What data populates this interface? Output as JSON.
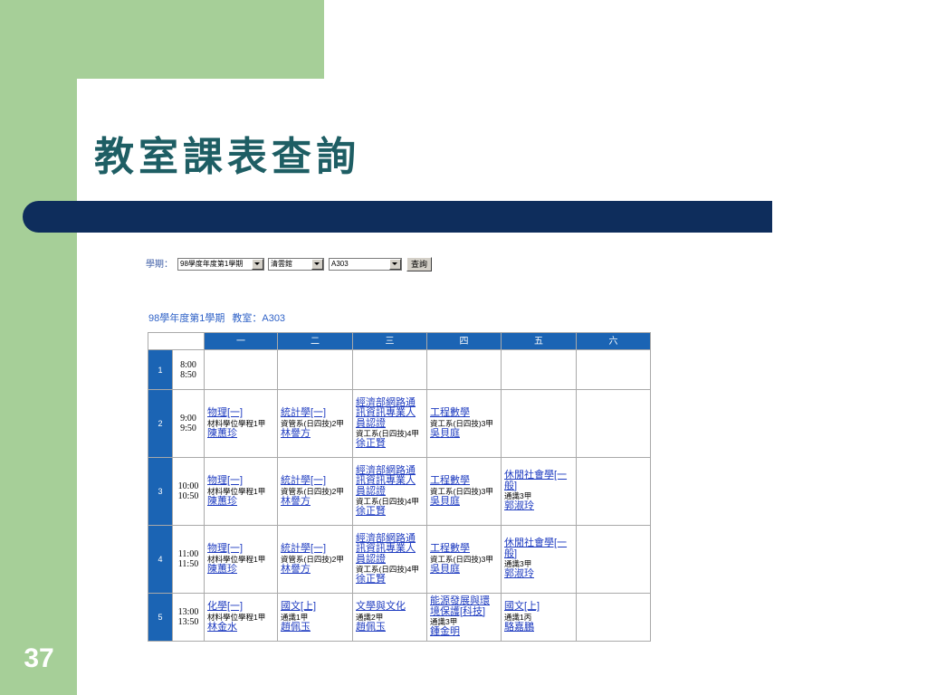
{
  "slide": {
    "title": "教室課表查詢",
    "page_number": "37"
  },
  "colors": {
    "slide_green": "#a6cf98",
    "title_text": "#1e5e64",
    "title_bar": "#0e2d5c",
    "table_header": "#1b64b4",
    "link": "#1f3cc0"
  },
  "form": {
    "semester_label": "學期：",
    "semester_select": "98學度年度第1學期",
    "building_select": "清雲館",
    "room_select": "A303",
    "query_button": "查詢"
  },
  "schedule": {
    "heading": {
      "semester": "98學年度第1學期",
      "room": "教室：A303"
    },
    "days": [
      "一",
      "二",
      "三",
      "四",
      "五",
      "六"
    ],
    "periods": [
      {
        "no": "1",
        "start": "8:00",
        "end": "8:50",
        "cells": [
          null,
          null,
          null,
          null,
          null,
          null
        ]
      },
      {
        "no": "2",
        "start": "9:00",
        "end": "9:50",
        "cells": [
          {
            "course": "物理[一]",
            "class": "材料學位學程1甲",
            "teacher": "陳蕙珍"
          },
          {
            "course": "統計學[一]",
            "class": "資管系(日四技)2甲",
            "teacher": "林譽方"
          },
          {
            "course": "經濟部網路通訊資訊專業人員認證",
            "class": "資工系(日四技)4甲",
            "teacher": "徐正賢"
          },
          {
            "course": "工程數學",
            "class": "資工系(日四技)3甲",
            "teacher": "吳貝庭"
          },
          null,
          null
        ]
      },
      {
        "no": "3",
        "start": "10:00",
        "end": "10:50",
        "cells": [
          {
            "course": "物理[一]",
            "class": "材料學位學程1甲",
            "teacher": "陳蕙珍"
          },
          {
            "course": "統計學[一]",
            "class": "資管系(日四技)2甲",
            "teacher": "林譽方"
          },
          {
            "course": "經濟部網路通訊資訊專業人員認證",
            "class": "資工系(日四技)4甲",
            "teacher": "徐正賢"
          },
          {
            "course": "工程數學",
            "class": "資工系(日四技)3甲",
            "teacher": "吳貝庭"
          },
          {
            "course": "休閒社會學[一般]",
            "class": "通識3甲",
            "teacher": "郭淑玲"
          },
          null
        ]
      },
      {
        "no": "4",
        "start": "11:00",
        "end": "11:50",
        "cells": [
          {
            "course": "物理[一]",
            "class": "材料學位學程1甲",
            "teacher": "陳蕙珍"
          },
          {
            "course": "統計學[一]",
            "class": "資管系(日四技)2甲",
            "teacher": "林譽方"
          },
          {
            "course": "經濟部網路通訊資訊專業人員認證",
            "class": "資工系(日四技)4甲",
            "teacher": "徐正賢"
          },
          {
            "course": "工程數學",
            "class": "資工系(日四技)3甲",
            "teacher": "吳貝庭"
          },
          {
            "course": "休閒社會學[一般]",
            "class": "通識3甲",
            "teacher": "郭淑玲"
          },
          null
        ]
      },
      {
        "no": "5",
        "start": "13:00",
        "end": "13:50",
        "cells": [
          {
            "course": "化學[一]",
            "class": "材料學位學程1甲",
            "teacher": "林金水"
          },
          {
            "course": "國文[上]",
            "class": "通識1甲",
            "teacher": "趙佩玉"
          },
          {
            "course": "文學與文化",
            "class": "通識2甲",
            "teacher": "趙佩玉"
          },
          {
            "course": "能源發展與環境保護[科技]",
            "class": "通識3甲",
            "teacher": "鍾金明"
          },
          {
            "course": "國文[上]",
            "class": "通識1丙",
            "teacher": "駱嘉鵬"
          },
          null
        ]
      }
    ]
  }
}
